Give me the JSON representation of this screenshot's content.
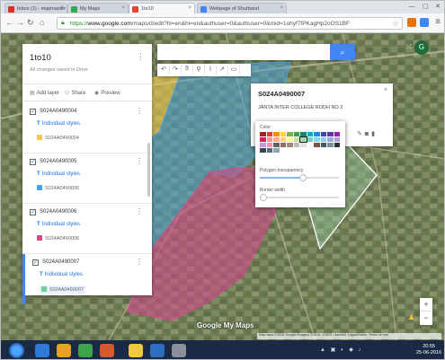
{
  "browser": {
    "tabs": [
      {
        "label": "Inbox (1) - mapmaster",
        "color": "#d93025"
      },
      {
        "label": "My Maps",
        "color": "#34a853"
      },
      {
        "label": "1to10",
        "color": "#ea4335"
      },
      {
        "label": "Webpage of Shurband",
        "color": "#4285f4"
      }
    ],
    "url_scheme": "https://",
    "url_host": "www.google.com",
    "url_path": "/maps/d/edit?hl=en&hl=en&authuser=0&authuser=0&mid=1ohyf7fPKagHp2oOS1BF"
  },
  "panel": {
    "title": "1to10",
    "saved_text": "All changes saved in Drive",
    "actions": [
      {
        "label": "Add layer",
        "icon": "add-layer-icon",
        "glyph": "▤"
      },
      {
        "label": "Share",
        "icon": "share-icon",
        "glyph": "⚇"
      },
      {
        "label": "Preview",
        "icon": "eye-icon",
        "glyph": "◉"
      }
    ],
    "layers": [
      {
        "name": "S024A0490004",
        "style": "Individual styles",
        "feature": "S024A0490004",
        "color": "#f2c94c",
        "active": false
      },
      {
        "name": "S024A0490005",
        "style": "Individual styles",
        "feature": "S024A0490005",
        "color": "#4aa3d8",
        "active": false
      },
      {
        "name": "S024A0490006",
        "style": "Individual styles",
        "feature": "S024A0490006",
        "color": "#d24a8a",
        "active": false
      },
      {
        "name": "S024A0490007",
        "style": "Individual styles",
        "feature": "S024A0490007",
        "color": "#6fcf97",
        "active": true
      }
    ]
  },
  "search": {
    "placeholder": "",
    "button_icon": "search-icon"
  },
  "info_window": {
    "title": "S024A0490007",
    "description": "JANTA INTER COLLEGE RODH NO 2"
  },
  "color_popup": {
    "color_label": "Color",
    "transparency_label": "Polygon transparency",
    "transparency_value": 0.55,
    "border_label": "Border width",
    "border_value": 0.05,
    "swatches": [
      "#b71c1c",
      "#e53935",
      "#fb8c00",
      "#fdd835",
      "#7cb342",
      "#43a047",
      "#00897b",
      "#00acc1",
      "#1e88e5",
      "#3949ab",
      "#5e35b1",
      "#8e24aa",
      "#d81b60",
      "#ef9a9a",
      "#ffab91",
      "#ffcc80",
      "#fff59d",
      "#c5e1a5",
      "#a5d6a7",
      "#80cbc4",
      "#80deea",
      "#90caf9",
      "#9fa8da",
      "#b39ddb",
      "#ce93d8",
      "#f48fb1",
      "#616161",
      "#8d6e63",
      "#a1887f",
      "#bdbdbd",
      "#e0e0e0",
      "#ffffff",
      "#795548",
      "#455a64",
      "#78909c",
      "#263238",
      "#37474f",
      "#546e7a",
      "#90a4ae"
    ],
    "selected_swatch": 18
  },
  "map": {
    "logo": "Google My Maps",
    "attribution": "Map data ©2016 Google Imagery ©2016, CNES / Astrium, DigitalGlobe, Terms of Use"
  },
  "zoom": {
    "in": "+",
    "out": "−"
  },
  "taskbar": {
    "time": "20:55",
    "date": "25-06-2016",
    "apps": [
      "#2f7ad6",
      "#e8a126",
      "#3ea44a",
      "#d65a2a",
      "#f2c744",
      "#2b6fc3",
      "#8a8f99"
    ]
  }
}
